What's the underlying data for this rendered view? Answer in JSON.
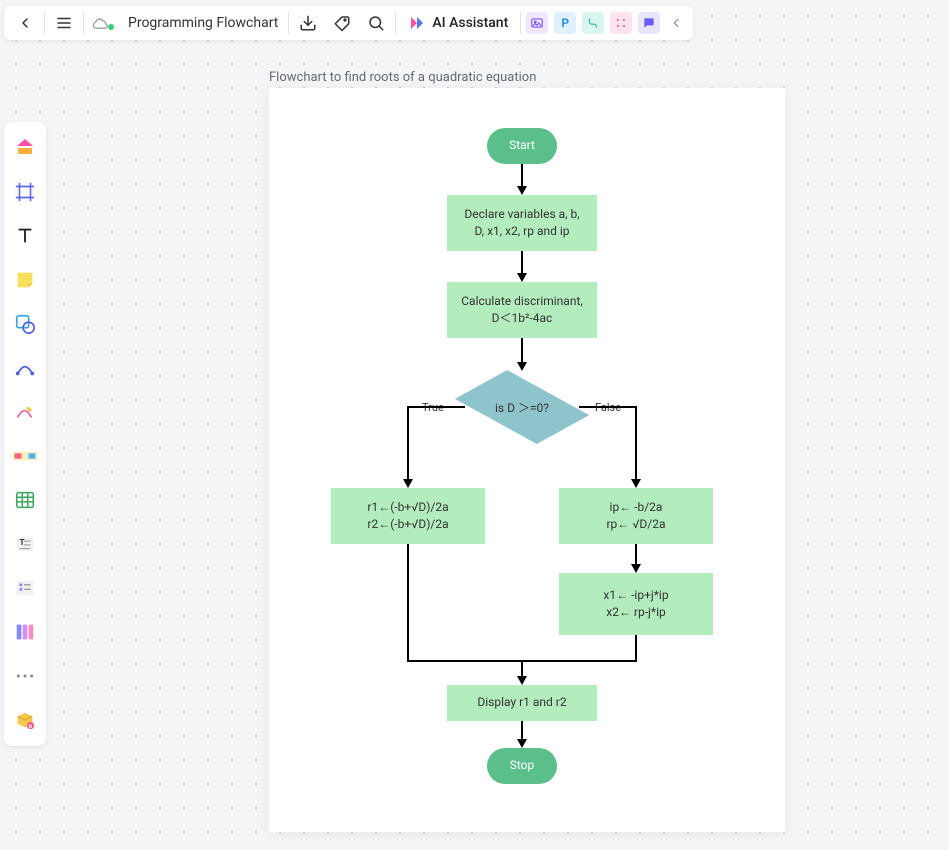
{
  "document": {
    "title": "Programming Flowchart"
  },
  "topbar": {
    "ai_label": "AI Assistant",
    "quick": {
      "p_label": "P"
    }
  },
  "canvas": {
    "heading": "Flowchart to find roots of a quadratic equation"
  },
  "flow": {
    "start": "Start",
    "declare": "Declare variables a, b,\nD, x1, x2, rp and ip",
    "calc": "Calculate discriminant,\nD＜1b²-4ac",
    "decision": "is D ＞=0?",
    "branch_true": "True",
    "branch_false": "False",
    "true_calc": "r1←(-b+√D)/2a\nr2←(-b+√D)/2a",
    "false_calc1": "ip← -b/2a\nrp← √D/2a",
    "false_calc2": "x1← -ip+j*ip\nx2← rp-j*ip",
    "display": "Display r1 and r2",
    "stop": "Stop"
  }
}
